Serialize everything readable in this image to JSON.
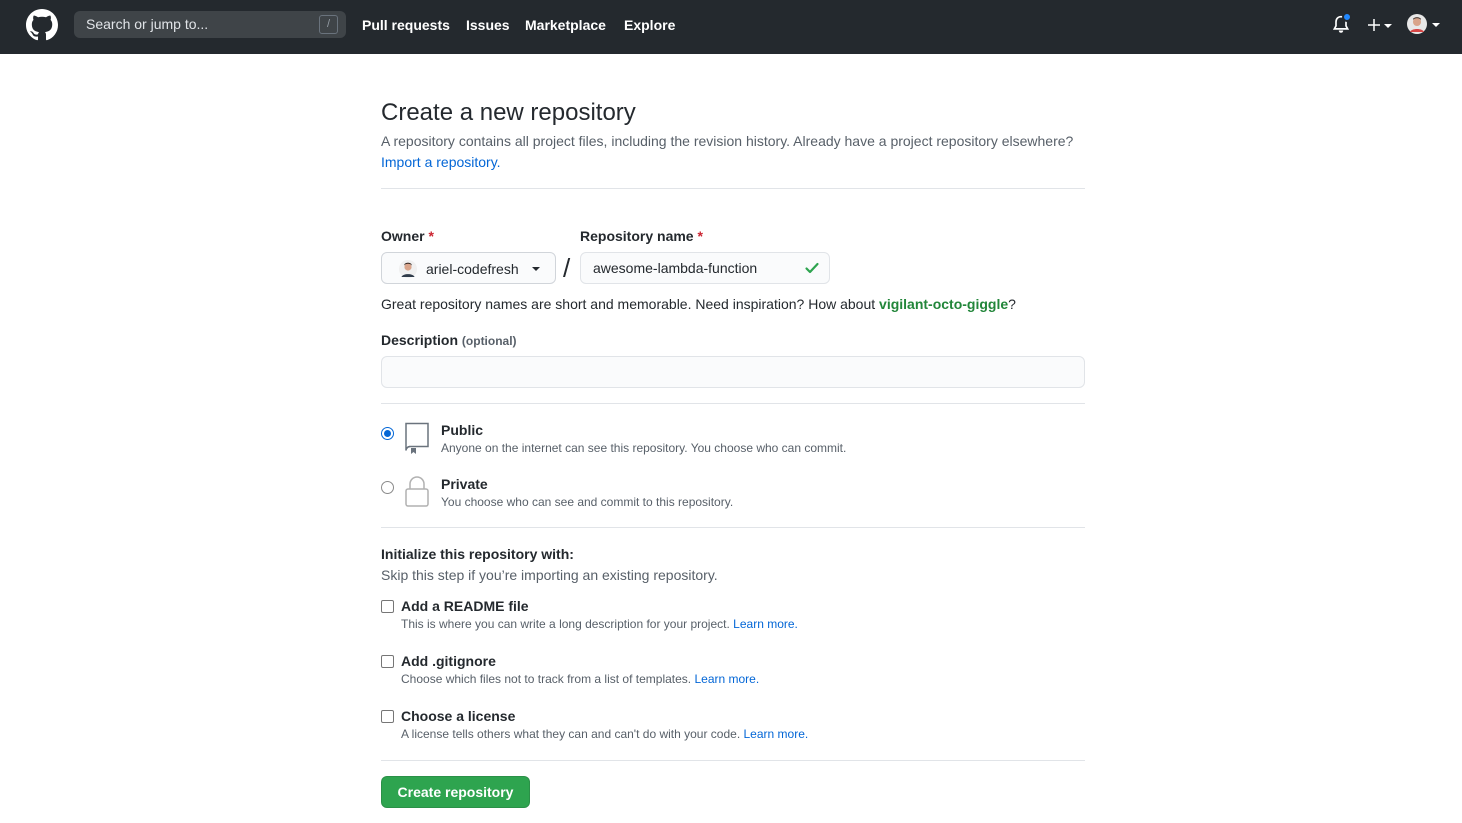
{
  "header": {
    "search_placeholder": "Search or jump to...",
    "search_shortcut": "/",
    "nav": [
      "Pull requests",
      "Issues",
      "Marketplace",
      "Explore"
    ],
    "bg_color": "#24292e"
  },
  "page": {
    "title": "Create a new repository",
    "subtitle": "A repository contains all project files, including the revision history. Already have a project repository elsewhere?",
    "import_link": "Import a repository."
  },
  "form": {
    "owner_label": "Owner",
    "owner_value": "ariel-codefresh",
    "separator": "/",
    "repo_label": "Repository name",
    "repo_value": "awesome-lambda-function",
    "required_mark": "*",
    "hint_prefix": "Great repository names are short and memorable. Need inspiration? How about",
    "hint_suggestion": "vigilant-octo-giggle",
    "hint_suffix": "?",
    "description_label": "Description",
    "description_optional": "(optional)",
    "description_value": ""
  },
  "visibility": {
    "public_title": "Public",
    "public_desc": "Anyone on the internet can see this repository. You choose who can commit.",
    "private_title": "Private",
    "private_desc": "You choose who can see and commit to this repository.",
    "selected": "public"
  },
  "initialize": {
    "title": "Initialize this repository with:",
    "subtitle": "Skip this step if you’re importing an existing repository.",
    "learn_more": "Learn more.",
    "options": [
      {
        "title": "Add a README file",
        "desc": "This is where you can write a long description for your project.",
        "checked": false
      },
      {
        "title": "Add .gitignore",
        "desc": "Choose which files not to track from a list of templates.",
        "checked": false
      },
      {
        "title": "Choose a license",
        "desc": "A license tells others what they can and can't do with your code.",
        "checked": false
      }
    ]
  },
  "submit_label": "Create repository",
  "colors": {
    "accent": "#0366d6",
    "success": "#2ea44f",
    "suggestion": "#22863a",
    "required": "#cb2431"
  }
}
